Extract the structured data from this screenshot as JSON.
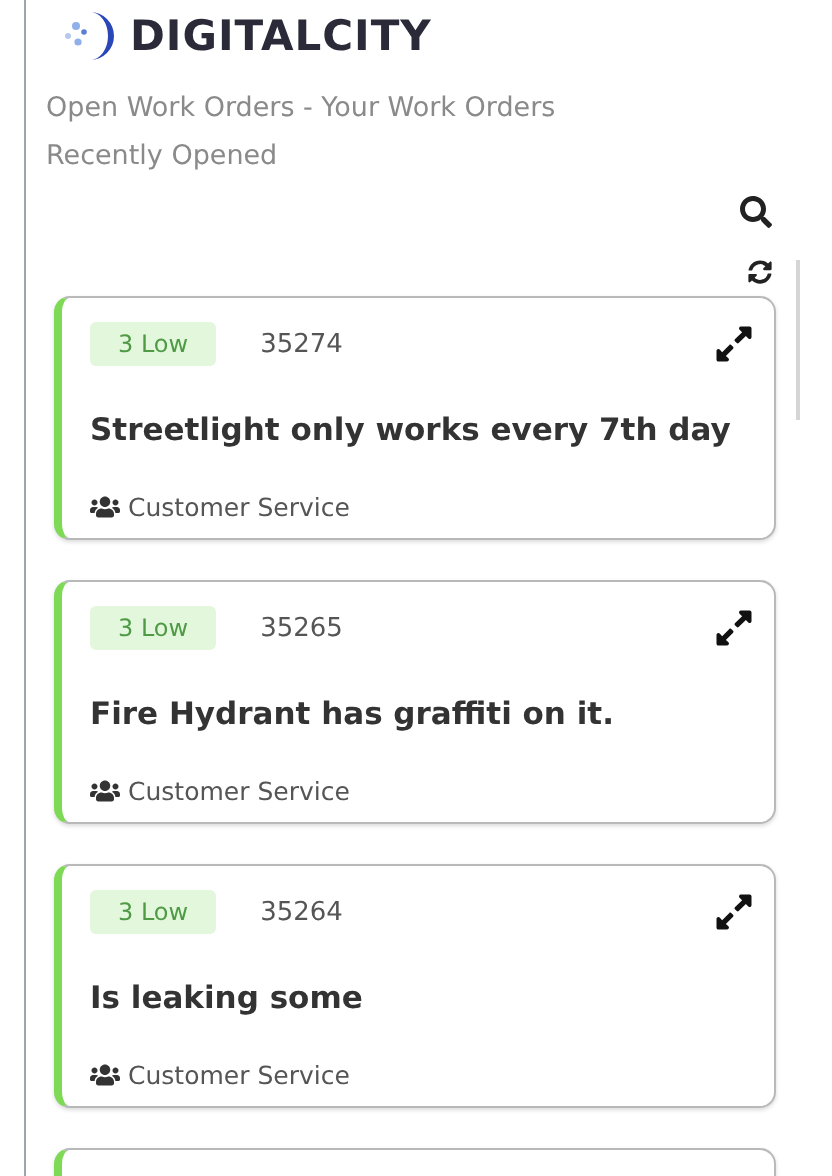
{
  "brand": "DIGITALCITY",
  "title": "Open Work Orders - Your Work Orders",
  "subtitle": "Recently Opened",
  "orders": [
    {
      "priority": "3 Low",
      "number": "35274",
      "summary": "Streetlight only works every 7th day",
      "team": "Customer Service",
      "color": "#7ed957"
    },
    {
      "priority": "3 Low",
      "number": "35265",
      "summary": "Fire Hydrant has graffiti on it.",
      "team": "Customer Service",
      "color": "#7ed957"
    },
    {
      "priority": "3 Low",
      "number": "35264",
      "summary": "Is leaking some",
      "team": "Customer Service",
      "color": "#7ed957"
    }
  ]
}
